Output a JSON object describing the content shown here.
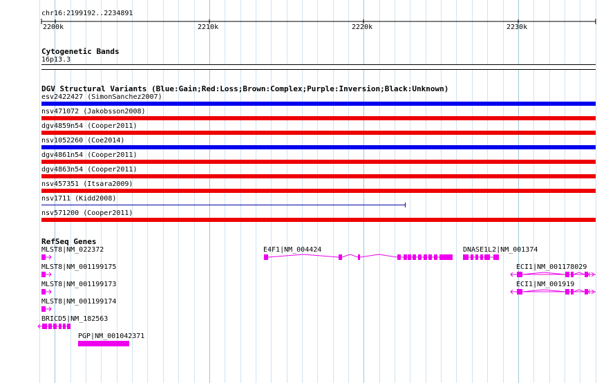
{
  "ruler": {
    "location": "chr16:2199192..2234891",
    "ticks": [
      "2200k",
      "2210k",
      "2220k",
      "2230k"
    ]
  },
  "cytoband": {
    "title": "Cytogenetic Bands",
    "band": "16p13.3"
  },
  "dgv": {
    "title": "DGV Structural Variants (Blue:Gain;Red:Loss;Brown:Complex;Purple:Inversion;Black:Unknown)",
    "colors": {
      "gain": "#0000ee",
      "loss": "#ee0000",
      "line": "#0000aa"
    },
    "variants": [
      {
        "label": "esv2422427 (SimonSanchez2007)",
        "type": "gain"
      },
      {
        "label": "nsv471072 (Jakobsson2008)",
        "type": "loss"
      },
      {
        "label": "dgv4859n54 (Cooper2011)",
        "type": "loss"
      },
      {
        "label": "nsv1052260 (Coe2014)",
        "type": "gain"
      },
      {
        "label": "dgv4861n54 (Cooper2011)",
        "type": "loss"
      },
      {
        "label": "dgv4863n54 (Cooper2011)",
        "type": "loss"
      },
      {
        "label": "nsv457351 (Itsara2009)",
        "type": "loss"
      },
      {
        "label": "nsv1711 (Kidd2008)",
        "type": "line"
      },
      {
        "label": "nsv571200 (Cooper2011)",
        "type": "loss"
      }
    ]
  },
  "refseq": {
    "title": "RefSeq Genes",
    "color": "#ee00ee",
    "genes": [
      {
        "label": "MLST8|NM_022372"
      },
      {
        "label": "MLST8|NM_001199175"
      },
      {
        "label": "MLST8|NM_001199173"
      },
      {
        "label": "MLST8|NM_001199174"
      },
      {
        "label": "BRICD5|NM_182563"
      },
      {
        "label": "PGP|NM_001042371"
      },
      {
        "label": "E4F1|NM_004424"
      },
      {
        "label": "DNASE1L2|NM_001374"
      },
      {
        "label": "ECI1|NM_001178029"
      },
      {
        "label": "ECI1|NM_001919"
      }
    ]
  }
}
